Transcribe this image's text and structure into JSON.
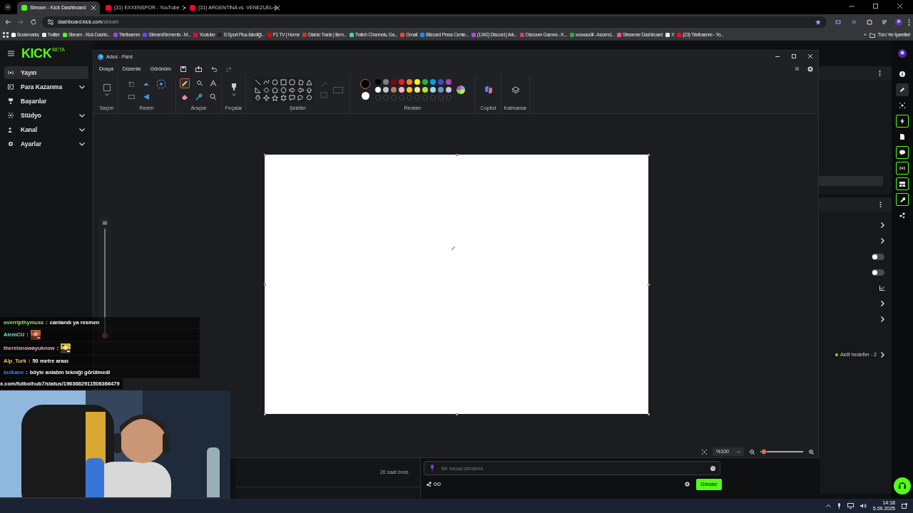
{
  "browser": {
    "tabs": [
      {
        "title": "Stream - Kick Dashboard",
        "selected": true,
        "color": "#53fc18"
      },
      {
        "title": "(31) EXXENSPOR - YouTube",
        "selected": false,
        "color": "#ff0033"
      },
      {
        "title": "(31) ARGENTINA vs. VENEZUEL",
        "selected": false,
        "color": "#ff0033"
      }
    ],
    "address": {
      "host": "dashboard.kick.com",
      "path": "/stream"
    },
    "bookmarks": [
      {
        "label": "Bookmarks",
        "color": "#ffffff"
      },
      {
        "label": "Twitter",
        "color": "#e7e9ea"
      },
      {
        "label": "Stream - Kick Dashb...",
        "color": "#53fc18"
      },
      {
        "label": "Trielbaenre",
        "color": "#9146ff"
      },
      {
        "label": "StreamElements - M...",
        "color": "#5b4bff"
      },
      {
        "label": "Youtube",
        "color": "#ff0033"
      },
      {
        "label": "S Sport Plus-İstediği...",
        "color": "#222222"
      },
      {
        "label": "F1 TV | Home",
        "color": "#e10600"
      },
      {
        "label": "Diablo Trade | Item...",
        "color": "#c0392b"
      },
      {
        "label": "Twitch Channels, Ga...",
        "color": "#4fd1a5"
      },
      {
        "label": "Gmail",
        "color": "#ea4335"
      },
      {
        "label": "Blizzard Press Cente...",
        "color": "#148eff"
      },
      {
        "label": "(1342) Discord | Ark...",
        "color": "#b44ad8"
      },
      {
        "label": "Discover Games - K...",
        "color": "#d63b6a"
      },
      {
        "label": "wowaudit - Ascend...",
        "color": "#2fa84f"
      },
      {
        "label": "Streamer Dashboard",
        "color": "#ff4f8b"
      },
      {
        "label": "X",
        "color": "#e7e9ea"
      },
      {
        "label": "(23) Trielbaenre - Yo...",
        "color": "#ff0033"
      }
    ],
    "bookmarks_more": "»",
    "all_bookmarks": "Tüm Yer İşaretleri"
  },
  "kick": {
    "logo": "KICK",
    "logo_badge": "BETA",
    "nav": [
      {
        "label": "Yayın",
        "selected": true,
        "expandable": false
      },
      {
        "label": "Para Kazanma",
        "selected": false,
        "expandable": true
      },
      {
        "label": "Başarılar",
        "selected": false,
        "expandable": false
      },
      {
        "label": "Stüdyo",
        "selected": false,
        "expandable": true
      },
      {
        "label": "Kanal",
        "selected": false,
        "expandable": true
      },
      {
        "label": "Ayarlar",
        "selected": false,
        "expandable": true
      }
    ],
    "panel_rows": [
      {
        "kind": "chevron"
      },
      {
        "kind": "chevron"
      },
      {
        "kind": "toggle",
        "on": false
      },
      {
        "kind": "toggle",
        "on": false
      },
      {
        "kind": "chart"
      },
      {
        "kind": "chevron"
      },
      {
        "kind": "chevron"
      },
      {
        "kind": "goals",
        "label": "Aktif hedefler - 2"
      }
    ],
    "rail": [
      {
        "outlined": false,
        "selected": false
      },
      {
        "outlined": false,
        "selected": true
      },
      {
        "outlined": false,
        "selected": false
      },
      {
        "outlined": true,
        "selected": false
      },
      {
        "outlined": false,
        "selected": false
      },
      {
        "outlined": true,
        "selected": false
      },
      {
        "outlined": true,
        "selected": false
      },
      {
        "outlined": true,
        "selected": false
      },
      {
        "outlined": true,
        "selected": false
      },
      {
        "outlined": false,
        "selected": false
      }
    ],
    "activity_time": "20 saat önce",
    "chat_input": {
      "placeholder": "Bir mesaj gönderin"
    },
    "send": "Gönder"
  },
  "paint": {
    "title": "Adsız - Paint",
    "menus": [
      "Dosya",
      "Düzenle",
      "Görünüm"
    ],
    "groups": [
      "Seçim",
      "Resim",
      "Araçlar",
      "Fırçalar",
      "Şekiller",
      "Renkler",
      "Copilot",
      "Katmanlar"
    ],
    "tools": [
      {
        "selected": true
      },
      {
        "selected": false
      },
      {
        "selected": false
      },
      {
        "selected": false
      },
      {
        "selected": false
      },
      {
        "selected": false
      }
    ],
    "current_colors": [
      {
        "color": "#000000",
        "selected": true
      },
      {
        "color": "#ffffff",
        "selected": false
      }
    ],
    "palette": [
      {
        "color": "#000000"
      },
      {
        "color": "#7f7f7f"
      },
      {
        "color": "#880015"
      },
      {
        "color": "#ed1c24"
      },
      {
        "color": "#ff7f27"
      },
      {
        "color": "#fff200"
      },
      {
        "color": "#22b14c"
      },
      {
        "color": "#00a2e8"
      },
      {
        "color": "#3f48cc"
      },
      {
        "color": "#a349a4"
      },
      {
        "color": "#ffffff"
      },
      {
        "color": "#c3c3c3"
      },
      {
        "color": "#b97a57"
      },
      {
        "color": "#ffaec9"
      },
      {
        "color": "#ffc90e"
      },
      {
        "color": "#efe4b0"
      },
      {
        "color": "#b5e61d"
      },
      {
        "color": "#99d9ea"
      },
      {
        "color": "#7092be"
      },
      {
        "color": "#c8bfe7"
      }
    ],
    "zoom": {
      "label": "%100",
      "level": 0.08
    }
  },
  "overlay": {
    "slider": {
      "level": 0
    },
    "chat": [
      {
        "kind": "text",
        "user": "overripthymuss",
        "separator": ":",
        "color": "#9be36b",
        "text": "canlandı ya resmen"
      },
      {
        "kind": "emote",
        "user": "AlemCU",
        "separator": ":",
        "color": "#7fe3c8"
      },
      {
        "kind": "emote",
        "user": "thereisnowayuknow",
        "separator": ":",
        "color": "#f2a7c8"
      },
      {
        "kind": "text",
        "user": "Alp_Turk",
        "separator": ":",
        "color": "#f0c674",
        "text": "50 metre arası"
      },
      {
        "kind": "text",
        "user": "bulkane",
        "separator": ":",
        "color": "#3b82f6",
        "text": "böyle anlatım tekniği görülmedi"
      }
    ],
    "link": "x.com/futbolhub7/status/1963682911506366479"
  },
  "taskbar": {
    "time": "14:18",
    "date": "5.09.2025"
  }
}
